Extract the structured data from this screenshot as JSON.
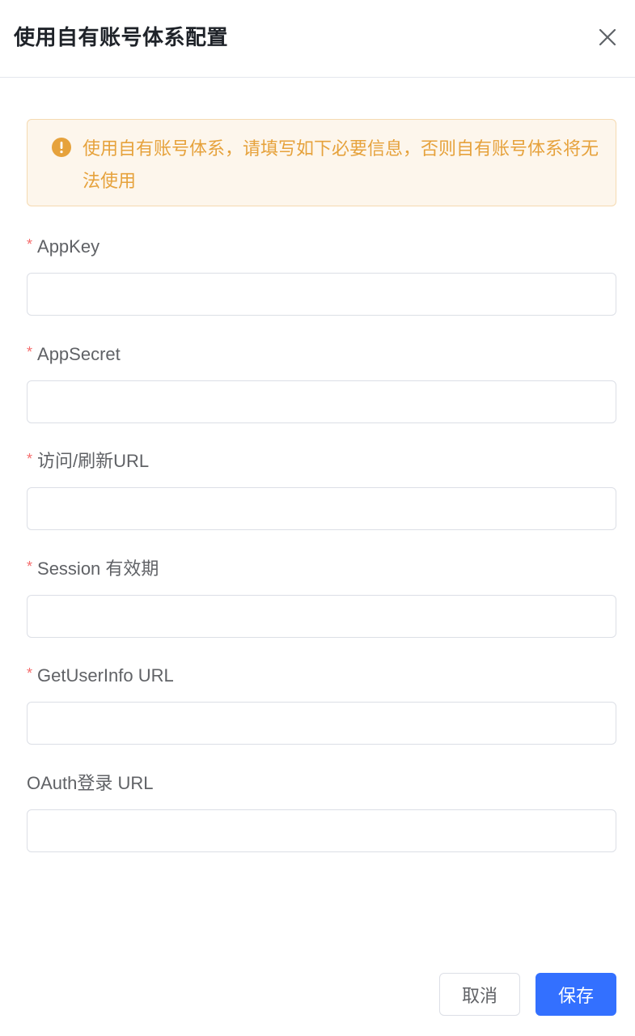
{
  "dialog": {
    "title": "使用自有账号体系配置",
    "close_icon": "close-icon"
  },
  "alert": {
    "icon": "warning-circle-icon",
    "message": "使用自有账号体系，请填写如下必要信息，否则自有账号体系将无法使用",
    "color": "#e6a23c",
    "background": "#fdf6ec"
  },
  "form": {
    "required_mark": "*",
    "fields": [
      {
        "label": "AppKey",
        "required": true,
        "value": "",
        "placeholder": ""
      },
      {
        "label": "AppSecret",
        "required": true,
        "value": "",
        "placeholder": ""
      },
      {
        "label": "访问/刷新URL",
        "required": true,
        "value": "",
        "placeholder": ""
      },
      {
        "label": "Session 有效期",
        "required": true,
        "value": "",
        "placeholder": ""
      },
      {
        "label": "GetUserInfo URL",
        "required": true,
        "value": "",
        "placeholder": ""
      },
      {
        "label": "OAuth登录 URL",
        "required": false,
        "value": "",
        "placeholder": ""
      }
    ]
  },
  "footer": {
    "cancel_label": "取消",
    "save_label": "保存",
    "primary_color": "#3370ff"
  }
}
